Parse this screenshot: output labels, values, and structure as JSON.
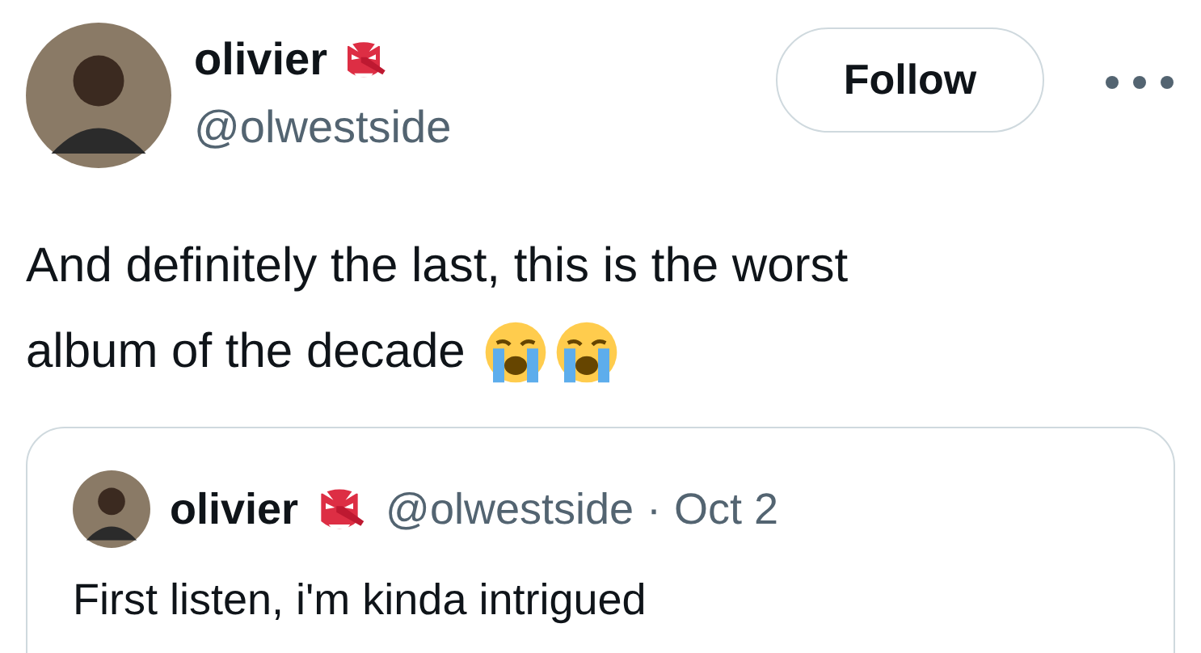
{
  "author": {
    "name": "olivier",
    "handle": "@olwestside"
  },
  "follow_button": {
    "label": "Follow"
  },
  "tweet": {
    "lines": [
      "And definitely the last, this is the worst",
      "album of the decade"
    ]
  },
  "quoted_tweet": {
    "name": "olivier",
    "handle": "@olwestside",
    "separator": "·",
    "date": "Oct 2",
    "text": "First listen, i'm kinda intrigued"
  }
}
